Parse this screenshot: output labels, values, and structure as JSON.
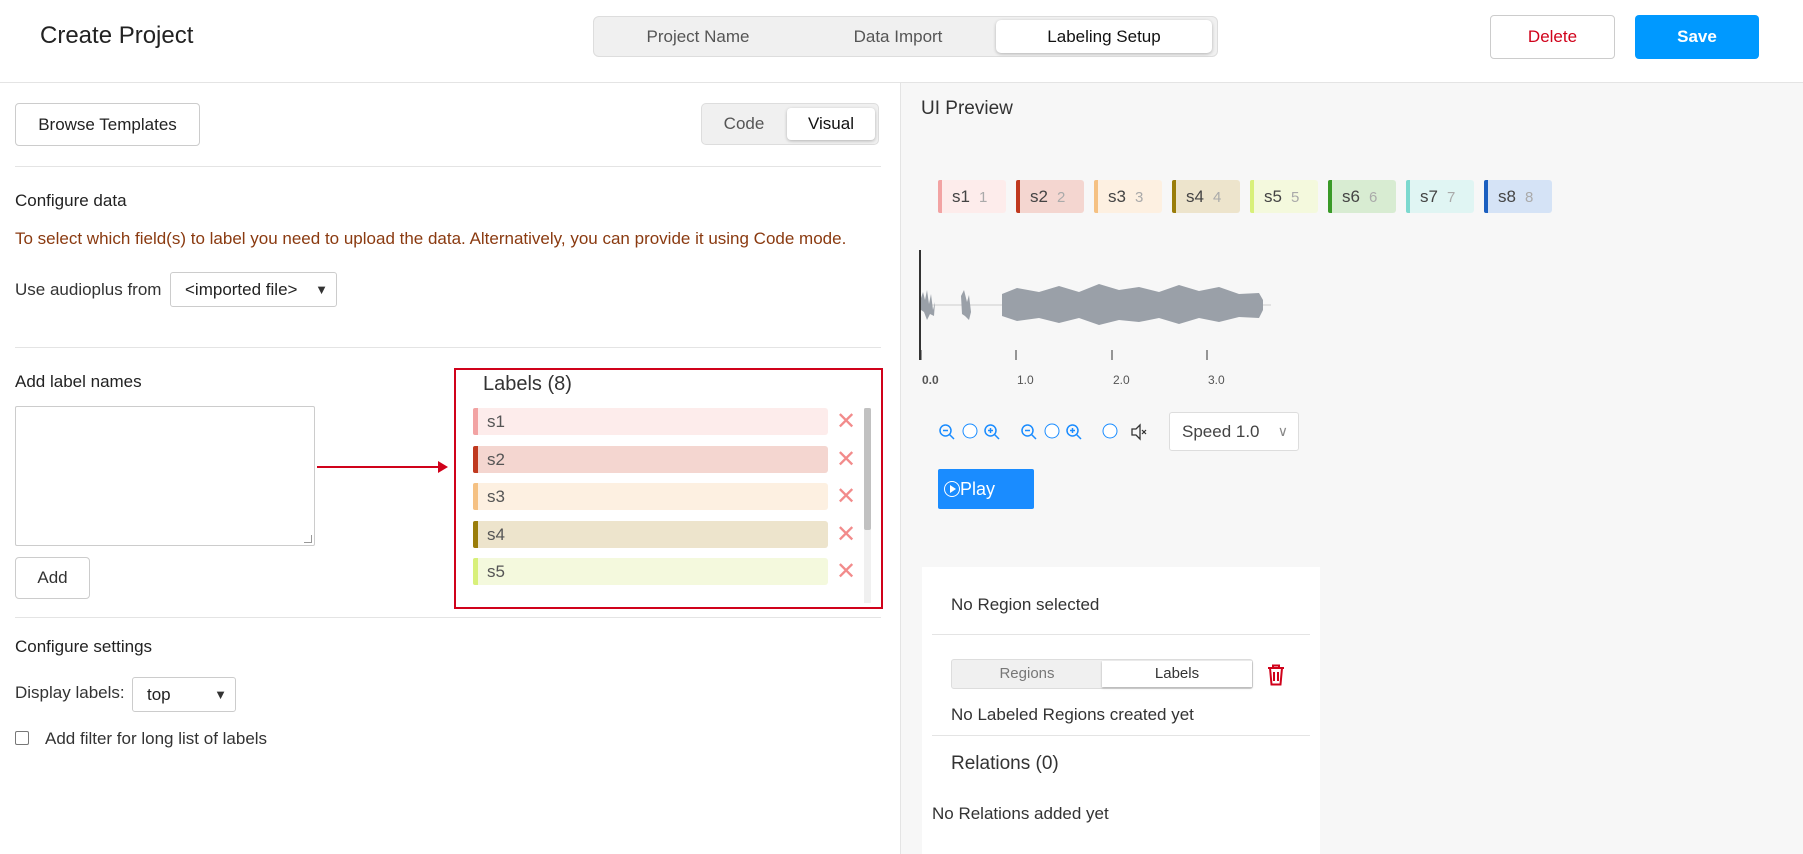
{
  "header": {
    "title": "Create Project",
    "steps": [
      "Project Name",
      "Data Import",
      "Labeling Setup"
    ],
    "active_step": "Labeling Setup",
    "delete_label": "Delete",
    "save_label": "Save"
  },
  "left": {
    "browse_label": "Browse Templates",
    "mode_code": "Code",
    "mode_visual": "Visual",
    "configure_data_title": "Configure data",
    "configure_data_hint": "To select which field(s) to label you need to upload the data. Alternatively, you can provide it using Code mode.",
    "use_field_label": "Use audioplus from",
    "use_field_value": "<imported file>",
    "add_label_title": "Add label names",
    "add_button": "Add",
    "labels_title": "Labels (8)",
    "labels": [
      {
        "name": "s1",
        "color": "#f2a3a3",
        "bg": "#fdeceb"
      },
      {
        "name": "s2",
        "color": "#c0391f",
        "bg": "#f4d6d0"
      },
      {
        "name": "s3",
        "color": "#f5c183",
        "bg": "#fdf0e1"
      },
      {
        "name": "s4",
        "color": "#9a7d0a",
        "bg": "#ede4cc"
      },
      {
        "name": "s5",
        "color": "#d8f07a",
        "bg": "#f4f9dd"
      }
    ],
    "configure_settings_title": "Configure settings",
    "display_labels_label": "Display labels:",
    "display_labels_value": "top",
    "filter_label": "Add filter for long list of labels"
  },
  "preview": {
    "title": "UI Preview",
    "chips": [
      {
        "name": "s1",
        "key": "1",
        "color": "#f2a3a3",
        "bg": "#fdeceb"
      },
      {
        "name": "s2",
        "key": "2",
        "color": "#c0391f",
        "bg": "#f4d6d0"
      },
      {
        "name": "s3",
        "key": "3",
        "color": "#f5c183",
        "bg": "#fdf0e1"
      },
      {
        "name": "s4",
        "key": "4",
        "color": "#9a7d0a",
        "bg": "#ede4cc"
      },
      {
        "name": "s5",
        "key": "5",
        "color": "#d8f07a",
        "bg": "#f4f9dd"
      },
      {
        "name": "s6",
        "key": "6",
        "color": "#3a9a28",
        "bg": "#d8ecd2"
      },
      {
        "name": "s7",
        "key": "7",
        "color": "#7dd9cf",
        "bg": "#e0f5f3"
      },
      {
        "name": "s8",
        "key": "8",
        "color": "#1b5fc0",
        "bg": "#d5e3f6"
      }
    ],
    "ticks": [
      "0.0",
      "1.0",
      "2.0",
      "3.0"
    ],
    "speed_label": "Speed 1.0",
    "play_label": "Play",
    "no_region": "No Region selected",
    "tab_regions": "Regions",
    "tab_labels": "Labels",
    "no_labeled": "No Labeled Regions created yet",
    "relations_title": "Relations (0)",
    "no_relations": "No Relations added yet"
  }
}
